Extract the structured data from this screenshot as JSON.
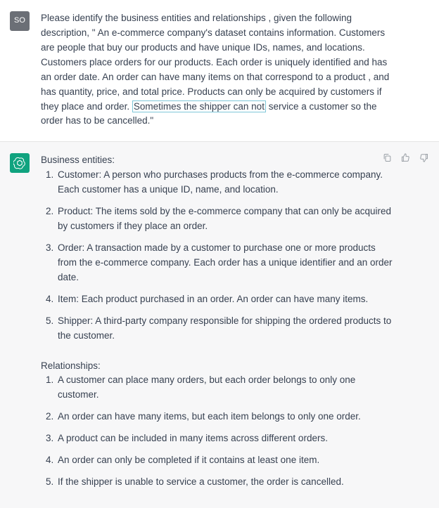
{
  "user": {
    "avatar_initials": "SO",
    "prompt_before_highlight": "Please identify the business entities and relationships , given the following description, \" An e-commerce company's dataset contains information.  Customers are people that buy our products and have unique IDs, names, and locations. Customers place orders for our products.  Each order is uniquely identified and has an order date.  An order can have many items on that correspond to a product , and has quantity, price, and total price. Products can only be acquired by customers if they place and order. ",
    "prompt_highlight": "Sometimes the shipper can not",
    "prompt_after_highlight": " service a customer so the order has to be cancelled.\""
  },
  "assistant": {
    "entities_label": "Business entities:",
    "entities": [
      "Customer: A person who purchases products from the e-commerce company. Each customer has a unique ID, name, and location.",
      "Product: The items sold by the e-commerce company that can only be acquired by customers if they place an order.",
      "Order: A transaction made by a customer to purchase one or more products from the e-commerce company. Each order has a unique identifier and an order date.",
      "Item: Each product purchased in an order. An order can have many items.",
      "Shipper: A third-party company responsible for shipping the ordered products to the customer."
    ],
    "relationships_label": "Relationships:",
    "relationships": [
      "A customer can place many orders, but each order belongs to only one customer.",
      "An order can have many items, but each item belongs to only one order.",
      "A product can be included in many items across different orders.",
      "An order can only be completed if it contains at least one item.",
      "If the shipper is unable to service a customer, the order is cancelled."
    ]
  },
  "icons": {
    "copy": "copy-icon",
    "thumbs_up": "thumbs-up-icon",
    "thumbs_down": "thumbs-down-icon"
  }
}
